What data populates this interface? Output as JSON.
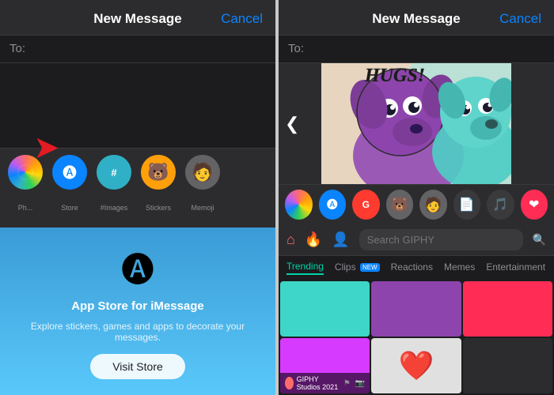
{
  "panel_left": {
    "header": {
      "title": "New Message",
      "cancel": "Cancel"
    },
    "to_label": "To:",
    "app_bar": {
      "icons": [
        {
          "id": "photos",
          "label": "Ph...",
          "color": "#conic"
        },
        {
          "id": "store",
          "label": "Store",
          "color": "#0a84ff"
        },
        {
          "id": "images",
          "label": "#Images",
          "color": "#30b0c7"
        },
        {
          "id": "stickers",
          "label": "Stickers",
          "color": "#ff9f0a"
        },
        {
          "id": "memoji",
          "label": "Memoji",
          "color": "#636366"
        }
      ]
    },
    "store_popup": {
      "icon": "🅐",
      "title": "App Store for iMessage",
      "subtitle": "Explore stickers, games and apps to decorate your messages.",
      "visit_button": "Visit Store"
    }
  },
  "panel_right": {
    "header": {
      "title": "New Message",
      "cancel": "Cancel"
    },
    "to_label": "To:",
    "gif_text": "SENDING\nHUGS!",
    "giphy": {
      "search_placeholder": "Search GIPHY",
      "tabs": [
        {
          "label": "Trending",
          "active": true
        },
        {
          "label": "Clips",
          "badge": "NEW"
        },
        {
          "label": "Reactions"
        },
        {
          "label": "Memes"
        },
        {
          "label": "Entertainment"
        }
      ],
      "studio_label": "GIPHY Studios 2021"
    }
  }
}
